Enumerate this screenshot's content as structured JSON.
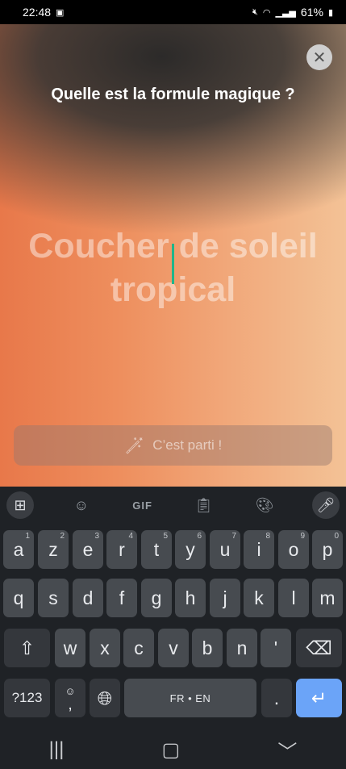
{
  "status_bar": {
    "time": "22:48",
    "battery": "61%",
    "left_icon": "battery-saver-icon",
    "right_icons": [
      "mute-icon",
      "wifi-icon",
      "signal-icon",
      "battery-icon"
    ]
  },
  "screen": {
    "question": "Quelle est la formule magique ?",
    "prompt_text": "Coucher de soleil tropical",
    "go_button_label": "C’est parti !",
    "go_button_icon": "magic-wand-icon",
    "close_icon": "close-icon"
  },
  "keyboard": {
    "toolbar": [
      "apps-grid-icon",
      "sticker-icon",
      "GIF",
      "clipboard-icon",
      "palette-icon",
      "mic-icon"
    ],
    "gif_label": "GIF",
    "row1": [
      {
        "k": "a",
        "h": "1"
      },
      {
        "k": "z",
        "h": "2"
      },
      {
        "k": "e",
        "h": "3"
      },
      {
        "k": "r",
        "h": "4"
      },
      {
        "k": "t",
        "h": "5"
      },
      {
        "k": "y",
        "h": "6"
      },
      {
        "k": "u",
        "h": "7"
      },
      {
        "k": "i",
        "h": "8"
      },
      {
        "k": "o",
        "h": "9"
      },
      {
        "k": "p",
        "h": "0"
      }
    ],
    "row2": [
      "q",
      "s",
      "d",
      "f",
      "g",
      "h",
      "j",
      "k",
      "l",
      "m"
    ],
    "row3": [
      "w",
      "x",
      "c",
      "v",
      "b",
      "n",
      "'"
    ],
    "num_label": "?123",
    "emoji_comma_label": ",",
    "space_label": "FR • EN",
    "period_label": ".",
    "shift_icon": "shift-icon",
    "backspace_icon": "backspace-icon",
    "globe_icon": "globe-icon",
    "enter_icon": "enter-icon"
  },
  "navbar": [
    "recents-icon",
    "home-icon",
    "back-icon"
  ]
}
